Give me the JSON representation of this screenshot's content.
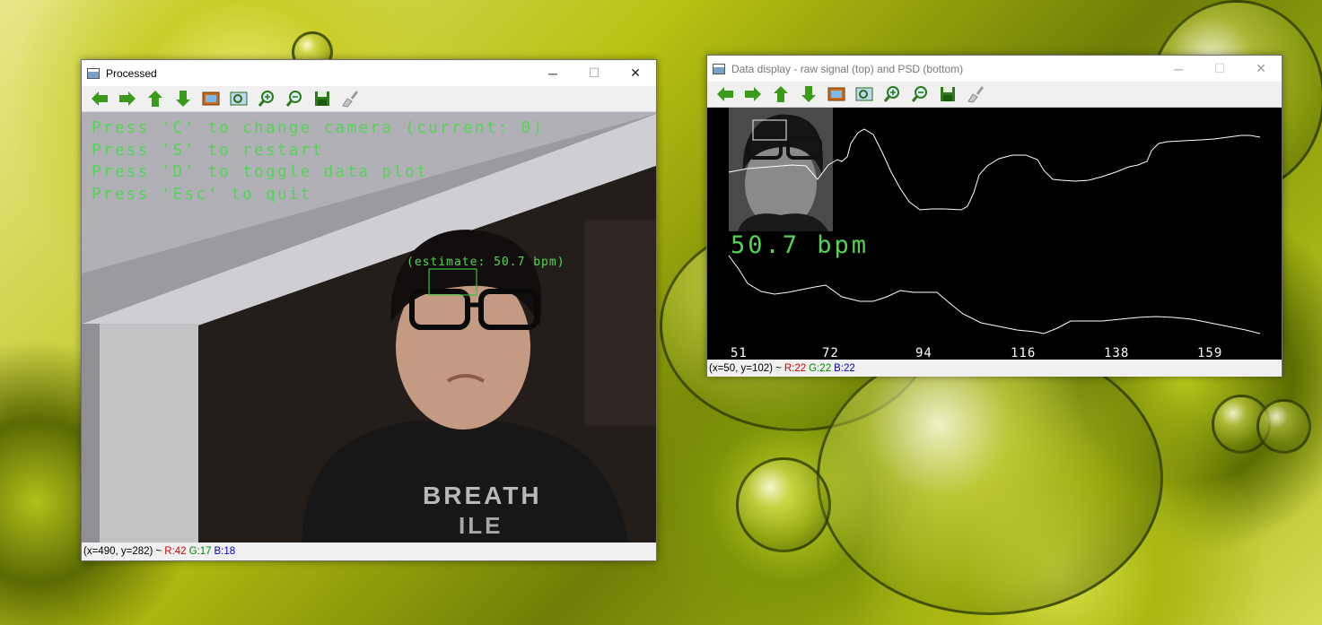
{
  "processed_window": {
    "title": "Processed",
    "overlay_lines": [
      "Press 'C' to change camera (current: 0)",
      "Press 'S' to restart",
      "Press 'D' to toggle data plot",
      "Press 'Esc' to quit"
    ],
    "estimate_label": "(estimate: 50.7 bpm)",
    "shirt_text_top": "BREATH",
    "shirt_text_bottom": "ILE",
    "status": {
      "coords": "(x=490, y=282) ~",
      "r": "R:42",
      "g": "G:17",
      "b": "B:18"
    }
  },
  "data_window": {
    "title": "Data display - raw signal (top) and PSD (bottom)",
    "bpm_label": "50.7 bpm",
    "freq_labels": [
      "51",
      "72",
      "94",
      "116",
      "138",
      "159"
    ],
    "status": {
      "coords": "(x=50, y=102) ~",
      "r": "R:22",
      "g": "G:22",
      "b": "B:22"
    }
  },
  "window_controls": {
    "minimize": "─",
    "maximize": "☐",
    "close": "✕"
  },
  "toolbar_icons": [
    "arrow-left-icon",
    "arrow-right-icon",
    "arrow-up-icon",
    "arrow-down-icon",
    "image-icon",
    "zoom-fit-icon",
    "zoom-in-icon",
    "zoom-out-icon",
    "save-icon",
    "brush-icon"
  ],
  "colors": {
    "overlay_green": "#54d454",
    "plot_line": "#ffffff",
    "toolbar_green": "#3a9a1a"
  }
}
